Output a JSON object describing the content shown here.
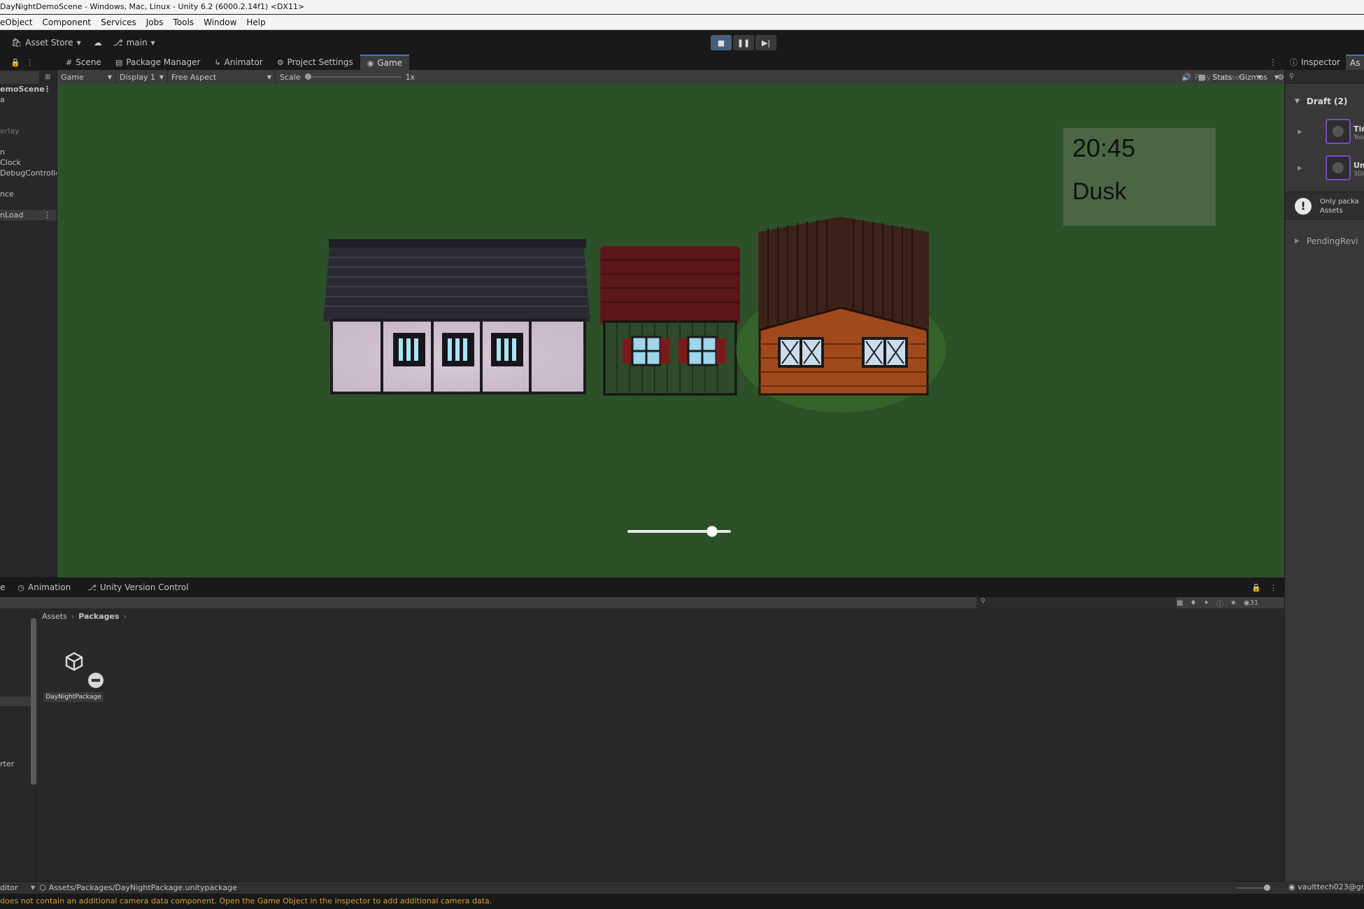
{
  "window": {
    "title": "DayNightDemoScene - Windows, Mac, Linux - Unity 6.2 (6000.2.14f1) <DX11>"
  },
  "menu": [
    "eObject",
    "Component",
    "Services",
    "Jobs",
    "Tools",
    "Window",
    "Help"
  ],
  "toolbar": {
    "asset_store": "Asset Store",
    "branch": "main"
  },
  "tabs": [
    {
      "label": "Scene",
      "icon": "grid-icon"
    },
    {
      "label": "Package Manager",
      "icon": "package-icon"
    },
    {
      "label": "Animator",
      "icon": "animator-icon"
    },
    {
      "label": "Project Settings",
      "icon": "gear-icon"
    },
    {
      "label": "Game",
      "icon": "gamepad-icon",
      "active": true
    }
  ],
  "hierarchy": {
    "rows": [
      {
        "label": "emoScene",
        "bold": true
      },
      {
        "label": "a"
      },
      {
        "label": ""
      },
      {
        "label": ""
      },
      {
        "label": "erlay",
        "dim": true
      },
      {
        "label": ""
      },
      {
        "label": "n"
      },
      {
        "label": "Clock"
      },
      {
        "label": "DebugController"
      },
      {
        "label": ""
      },
      {
        "label": "nce"
      },
      {
        "label": ""
      },
      {
        "label": "nLoad",
        "selected": true
      }
    ]
  },
  "gamebar": {
    "mode": "Game",
    "display": "Display 1",
    "aspect": "Free Aspect",
    "scale_label": "Scale",
    "scale_value": "1x",
    "play_focus": "Play Focused",
    "stats": "Stats",
    "gizmos": "Gizmos"
  },
  "game": {
    "time": "20:45",
    "phase": "Dusk",
    "time_slider_fraction": 0.82
  },
  "inspector": {
    "tabs": [
      "Inspector",
      "As"
    ],
    "draft_header": "Draft (2)",
    "items": [
      {
        "title": "Tim",
        "subtitle": "Tool"
      },
      {
        "title": "Unti",
        "subtitle": "3D/F"
      }
    ],
    "warning": [
      "Only packa",
      "Assets"
    ],
    "pending": "PendingRevi"
  },
  "bottom_tabs": [
    {
      "label": "e"
    },
    {
      "label": "Animation",
      "icon": "clock-icon"
    },
    {
      "label": "Unity Version Control",
      "icon": "branch-icon"
    }
  ],
  "project": {
    "breadcrumb": [
      "Assets",
      "Packages"
    ],
    "asset_name": "DayNightPackage",
    "left_labels": [
      "rter",
      "",
      ""
    ],
    "count": "31"
  },
  "pathbar": {
    "left": "ditor",
    "path": "Assets/Packages/DayNightPackage.unitypackage"
  },
  "account": "vaulttech023@gr",
  "status": "does not contain an additional camera data component. Open the Game Object in the inspector to add additional camera data."
}
